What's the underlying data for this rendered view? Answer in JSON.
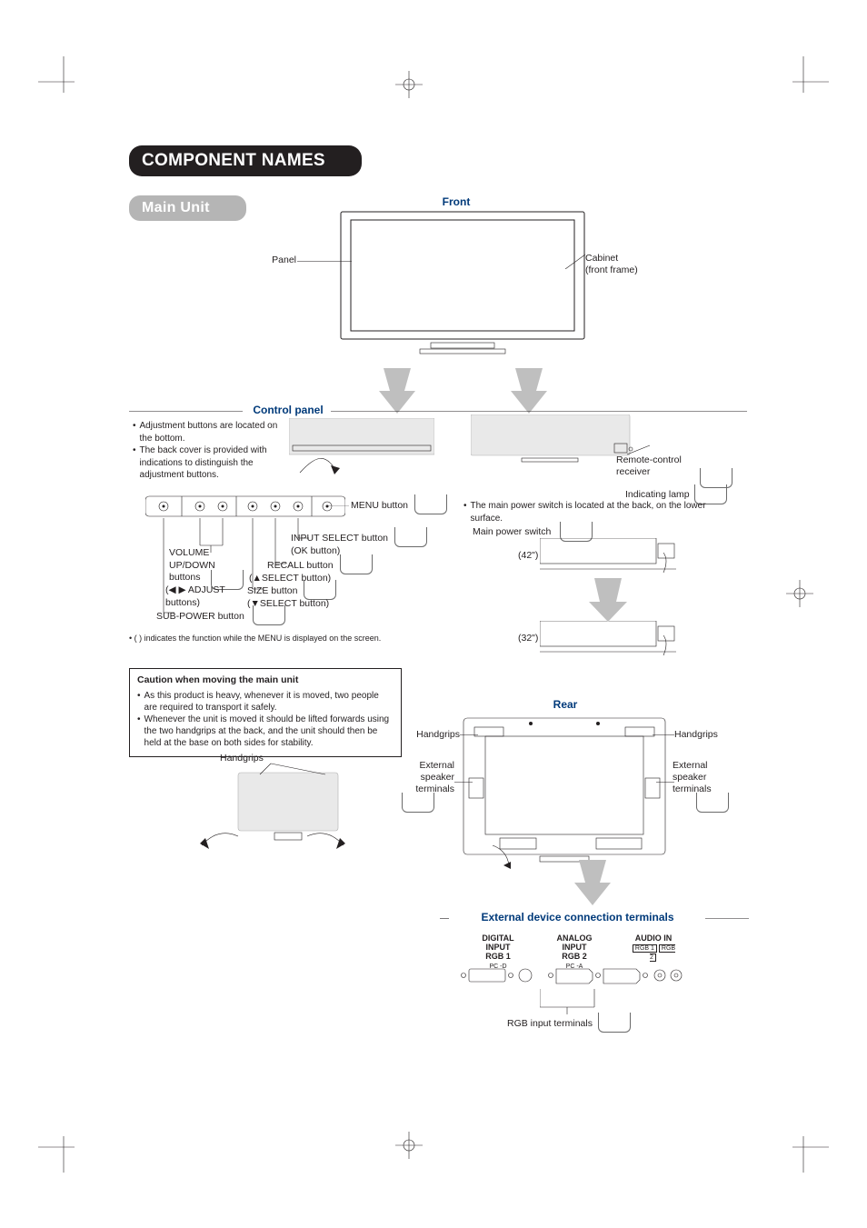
{
  "title": "COMPONENT NAMES",
  "subheading": "Main Unit",
  "front": {
    "heading": "Front",
    "panel_label": "Panel",
    "cabinet_line1": "Cabinet",
    "cabinet_line2": "(front frame)"
  },
  "control_panel": {
    "heading": "Control panel",
    "bullets": [
      "Adjustment buttons are located on the bottom.",
      "The back cover is provided with indications to distinguish the adjustment buttons."
    ],
    "right_bullet": "The main power switch is located at the back, on the lower surface.",
    "labels": {
      "remote_receiver": "Remote-control receiver",
      "indicating_lamp": "Indicating lamp",
      "main_power_switch": "Main power switch",
      "menu_button": "MENU button",
      "input_select": "INPUT SELECT button",
      "ok_button": "(OK button)",
      "recall_button": "RECALL button",
      "up_select": "(▲SELECT button)",
      "size_button": "SIZE button",
      "down_select": "(▼SELECT button)",
      "sub_power": "SUB-POWER button",
      "volume_line1": "VOLUME",
      "volume_line2": "UP/DOWN",
      "volume_line3": "buttons",
      "adjust_line": "(◀ ▶ ADJUST",
      "adjust_line2": "buttons)",
      "size_42": "(42\")",
      "size_32": "(32\")"
    },
    "note": "(  ) indicates the function while the MENU is displayed on the screen."
  },
  "caution": {
    "title": "Caution when moving the main unit",
    "bullets": [
      "As this product is heavy, whenever it is moved, two people are required to transport it safely.",
      "Whenever the unit is moved it should be lifted forwards using the two handgrips at the back, and the unit should then be held at the base on both sides for stability."
    ],
    "handgrips_label": "Handgrips"
  },
  "rear": {
    "heading": "Rear",
    "handgrips": "Handgrips",
    "ext_speaker": "External speaker terminals"
  },
  "ext_terminals": {
    "heading": "External device connection terminals",
    "rgb_label": "RGB input terminals",
    "digital_input": "DIGITAL INPUT",
    "rgb1": "RGB 1",
    "pc_d": "PC -D",
    "analog_input": "ANALOG INPUT",
    "rgb2": "RGB 2",
    "pc_a": "PC -A",
    "audio_in": "AUDIO IN",
    "audio_rgb1": "RGB 1",
    "audio_rgb2": "RGB 2"
  }
}
